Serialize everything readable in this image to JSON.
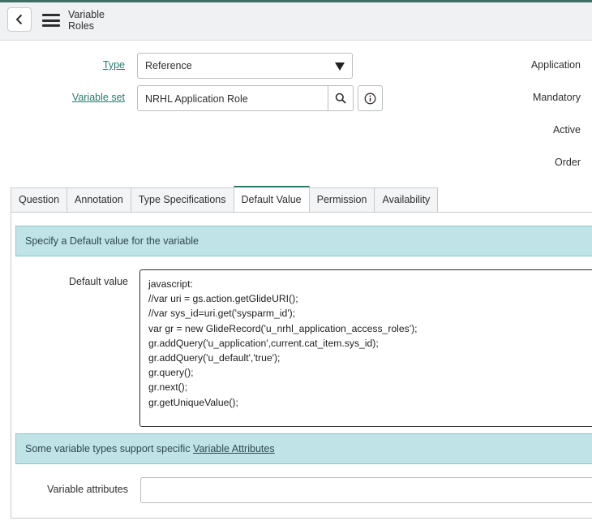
{
  "header": {
    "title_line1": "Variable",
    "title_line2": "Roles"
  },
  "form": {
    "type_label": "Type",
    "type_value": "Reference",
    "variable_set_label": "Variable set",
    "variable_set_value": "NRHL Application Role",
    "right_labels": [
      "Application",
      "Mandatory",
      "Active",
      "Order"
    ]
  },
  "tabs": [
    {
      "label": "Question"
    },
    {
      "label": "Annotation"
    },
    {
      "label": "Type Specifications"
    },
    {
      "label": "Default Value",
      "active": true
    },
    {
      "label": "Permission"
    },
    {
      "label": "Availability"
    }
  ],
  "default_value_tab": {
    "info_text": "Specify a Default value for the variable",
    "default_value_label": "Default value",
    "code_lines": [
      "javascript:",
      "//var uri = gs.action.getGlideURI();",
      "//var sys_id=uri.get('sysparm_id');",
      "var gr = new GlideRecord('u_nrhl_application_access_roles');",
      "gr.addQuery('u_application',current.cat_item.sys_id);",
      "gr.addQuery('u_default','true');",
      "gr.query();",
      "gr.next();",
      "gr.getUniqueValue();"
    ],
    "attributes_note_prefix": "Some variable types support specific ",
    "attributes_note_link": "Variable Attributes",
    "variable_attributes_label": "Variable attributes",
    "variable_attributes_value": ""
  },
  "colors": {
    "accent": "#2a7a6d",
    "info_bg": "#bfe3e6"
  }
}
